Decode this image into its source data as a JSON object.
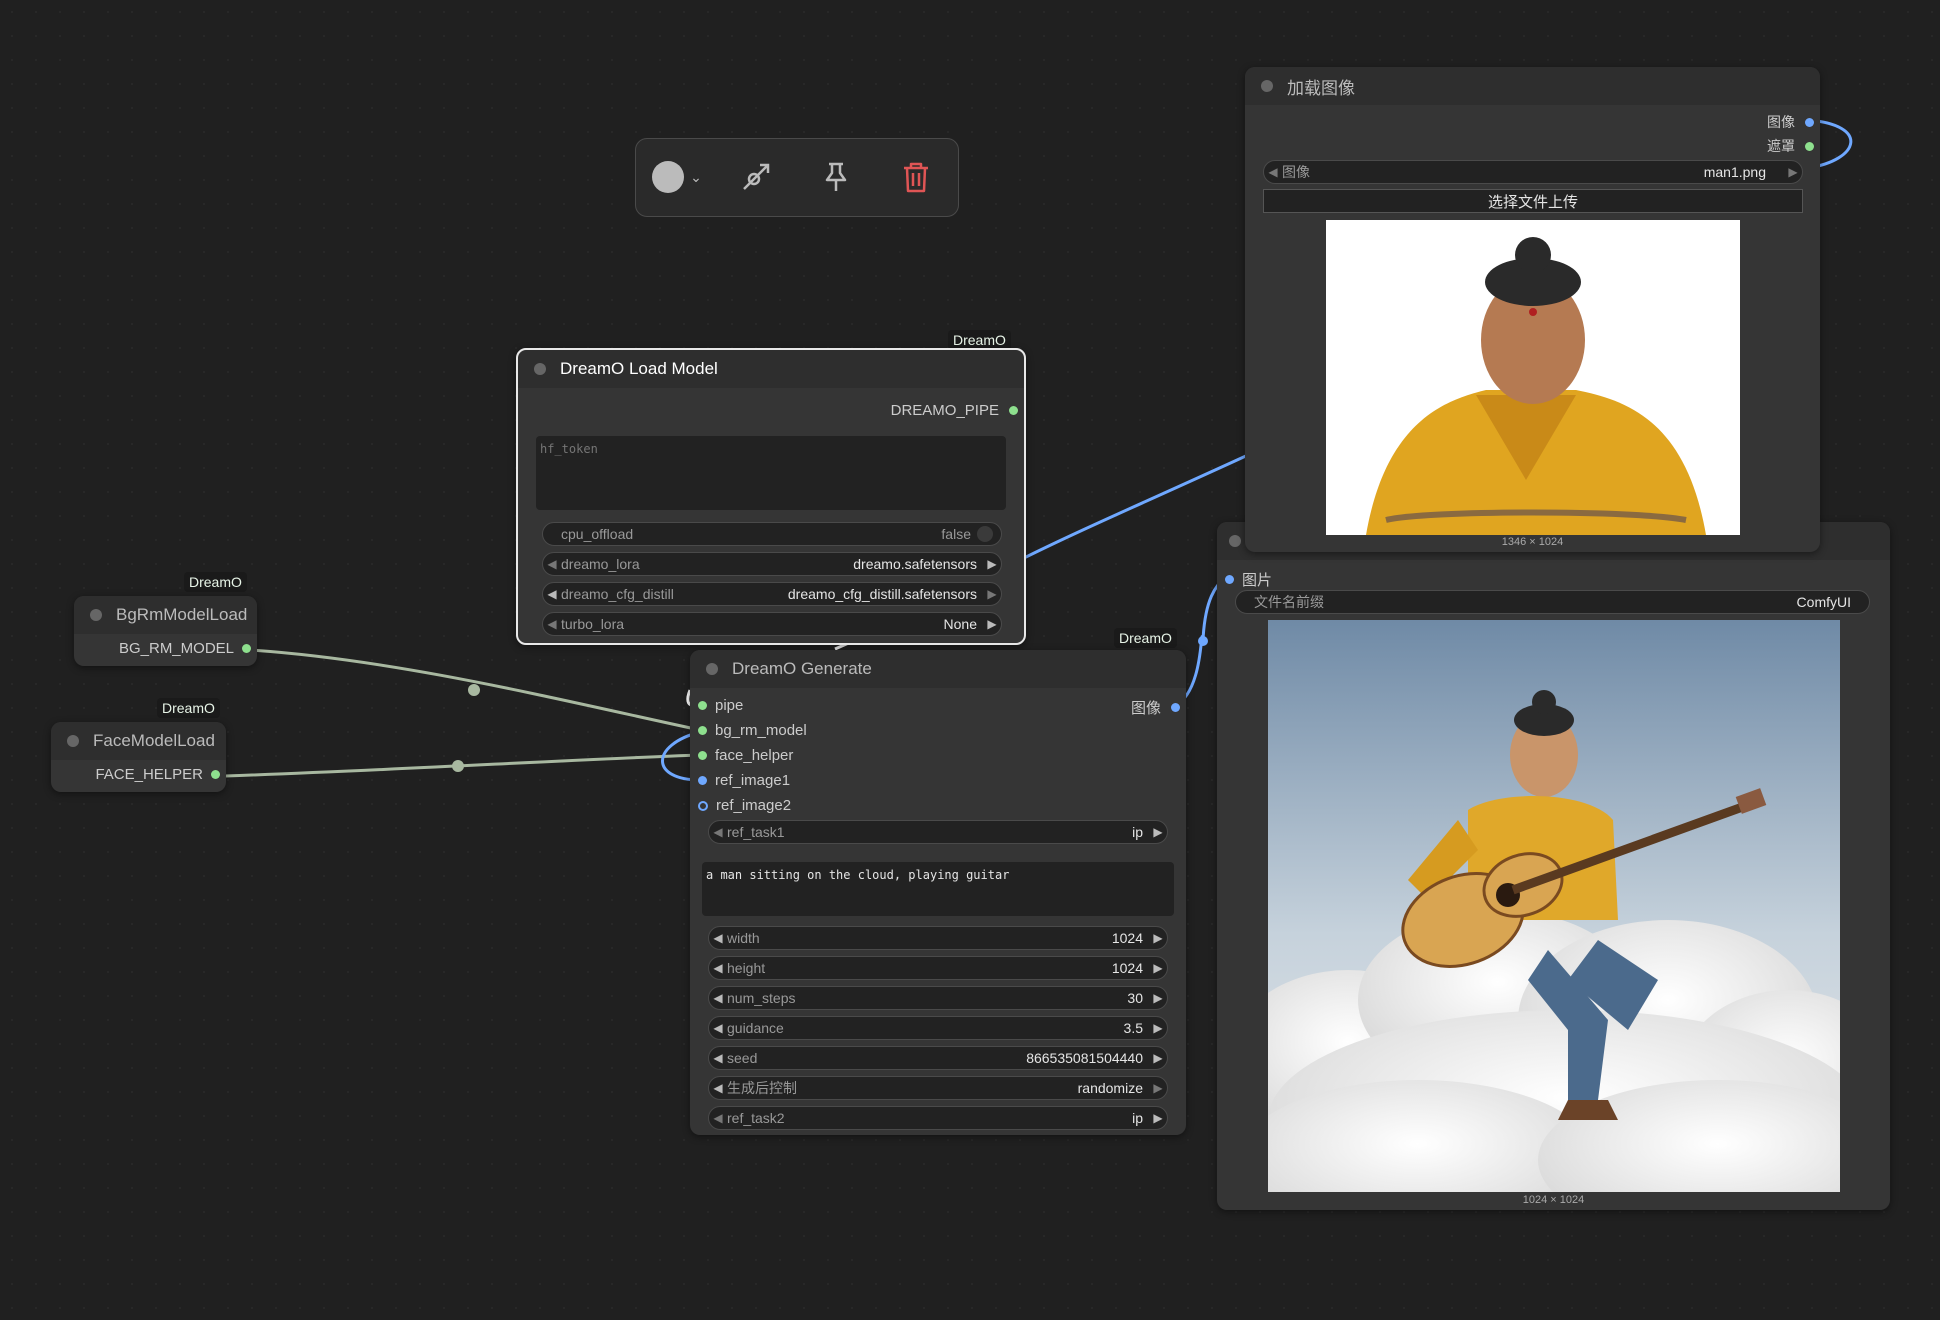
{
  "badges": {
    "group": "DreamO"
  },
  "toolbar": {
    "color_icon": "color-circle-icon",
    "bypass_icon": "bypass-icon",
    "pin_icon": "pin-icon",
    "delete_icon": "trash-icon",
    "delete_color": "#e05555"
  },
  "load_model": {
    "title": "DreamO Load Model",
    "output": "DREAMO_PIPE",
    "hf_token_placeholder": "hf_token",
    "widgets": [
      {
        "label": "cpu_offload",
        "value": "false"
      },
      {
        "label": "dreamo_lora",
        "value": "dreamo.safetensors"
      },
      {
        "label": "dreamo_cfg_distill",
        "value": "dreamo_cfg_distill.safetensors"
      },
      {
        "label": "turbo_lora",
        "value": "None"
      }
    ]
  },
  "bg_rm": {
    "title": "BgRmModelLoad",
    "output": "BG_RM_MODEL"
  },
  "face": {
    "title": "FaceModelLoad",
    "output": "FACE_HELPER"
  },
  "generate": {
    "title": "DreamO Generate",
    "inputs": [
      "pipe",
      "bg_rm_model",
      "face_helper",
      "ref_image1",
      "ref_image2"
    ],
    "output": "图像",
    "ref_task1": {
      "label": "ref_task1",
      "value": "ip"
    },
    "prompt": "a man sitting on the cloud, playing guitar",
    "widgets": [
      {
        "label": "width",
        "value": "1024"
      },
      {
        "label": "height",
        "value": "1024"
      },
      {
        "label": "num_steps",
        "value": "30"
      },
      {
        "label": "guidance",
        "value": "3.5"
      },
      {
        "label": "seed",
        "value": "866535081504440"
      },
      {
        "label": "生成后控制",
        "value": "randomize"
      },
      {
        "label": "ref_task2",
        "value": "ip"
      }
    ]
  },
  "load_image": {
    "title": "加载图像",
    "outputs": [
      "图像",
      "遮罩"
    ],
    "image_widget": {
      "label": "图像",
      "value": "man1.png"
    },
    "upload_label": "选择文件上传",
    "dims": "1346 × 1024"
  },
  "save_image": {
    "input": "图片",
    "prefix_widget": {
      "label": "文件名前缀",
      "value": "ComfyUI"
    },
    "dims": "1024 × 1024"
  },
  "colors": {
    "slot_green": "#8ee08e",
    "slot_blue": "#6fa8ff",
    "canvas": "#202020",
    "node": "#353535"
  }
}
